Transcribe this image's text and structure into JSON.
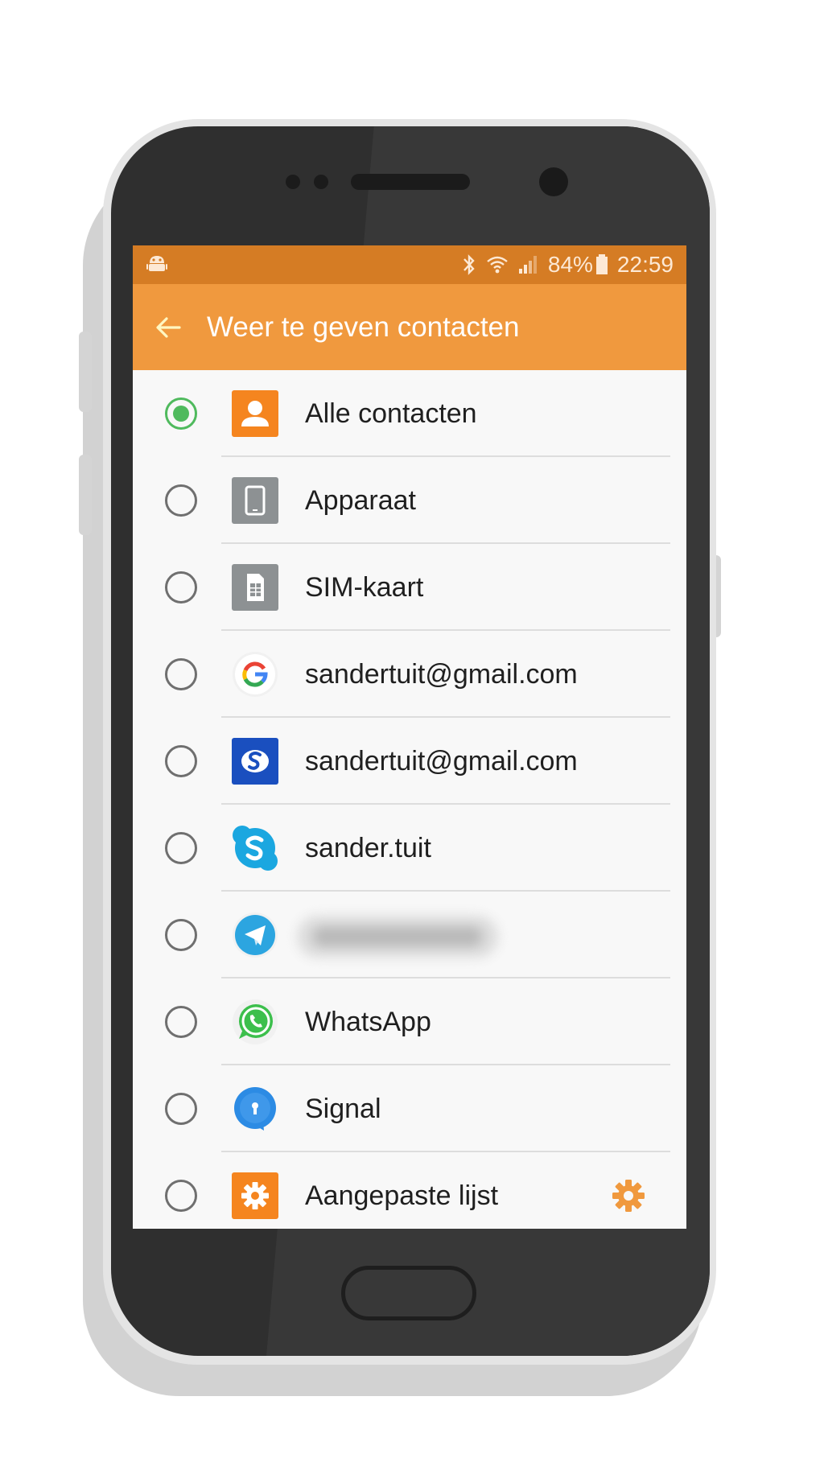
{
  "status_bar": {
    "battery": "84%",
    "time": "22:59",
    "icons": [
      "android-icon",
      "bluetooth-icon",
      "wifi-icon",
      "signal-icon",
      "battery-icon"
    ]
  },
  "app_bar": {
    "title": "Weer te geven contacten",
    "back_icon": "arrow-left-icon"
  },
  "list": [
    {
      "label": "Alle contacten",
      "icon": "contacts-icon",
      "selected": true
    },
    {
      "label": "Apparaat",
      "icon": "device-icon",
      "selected": false
    },
    {
      "label": "SIM-kaart",
      "icon": "sim-card-icon",
      "selected": false
    },
    {
      "label": "sandertuit@gmail.com",
      "icon": "google-icon",
      "selected": false
    },
    {
      "label": "sandertuit@gmail.com",
      "icon": "samsung-account-icon",
      "selected": false
    },
    {
      "label": "sander.tuit",
      "icon": "skype-icon",
      "selected": false
    },
    {
      "label": "",
      "icon": "telegram-icon",
      "selected": false,
      "blurred": true
    },
    {
      "label": "WhatsApp",
      "icon": "whatsapp-icon",
      "selected": false
    },
    {
      "label": "Signal",
      "icon": "signal-app-icon",
      "selected": false
    },
    {
      "label": "Aangepaste lijst",
      "icon": "custom-list-icon",
      "selected": false,
      "has_settings": true
    }
  ],
  "colors": {
    "status_bar": "#d57c24",
    "app_bar": "#f0993e",
    "radio_selected": "#4fba5d",
    "screen_bg": "#f8f8f8"
  }
}
